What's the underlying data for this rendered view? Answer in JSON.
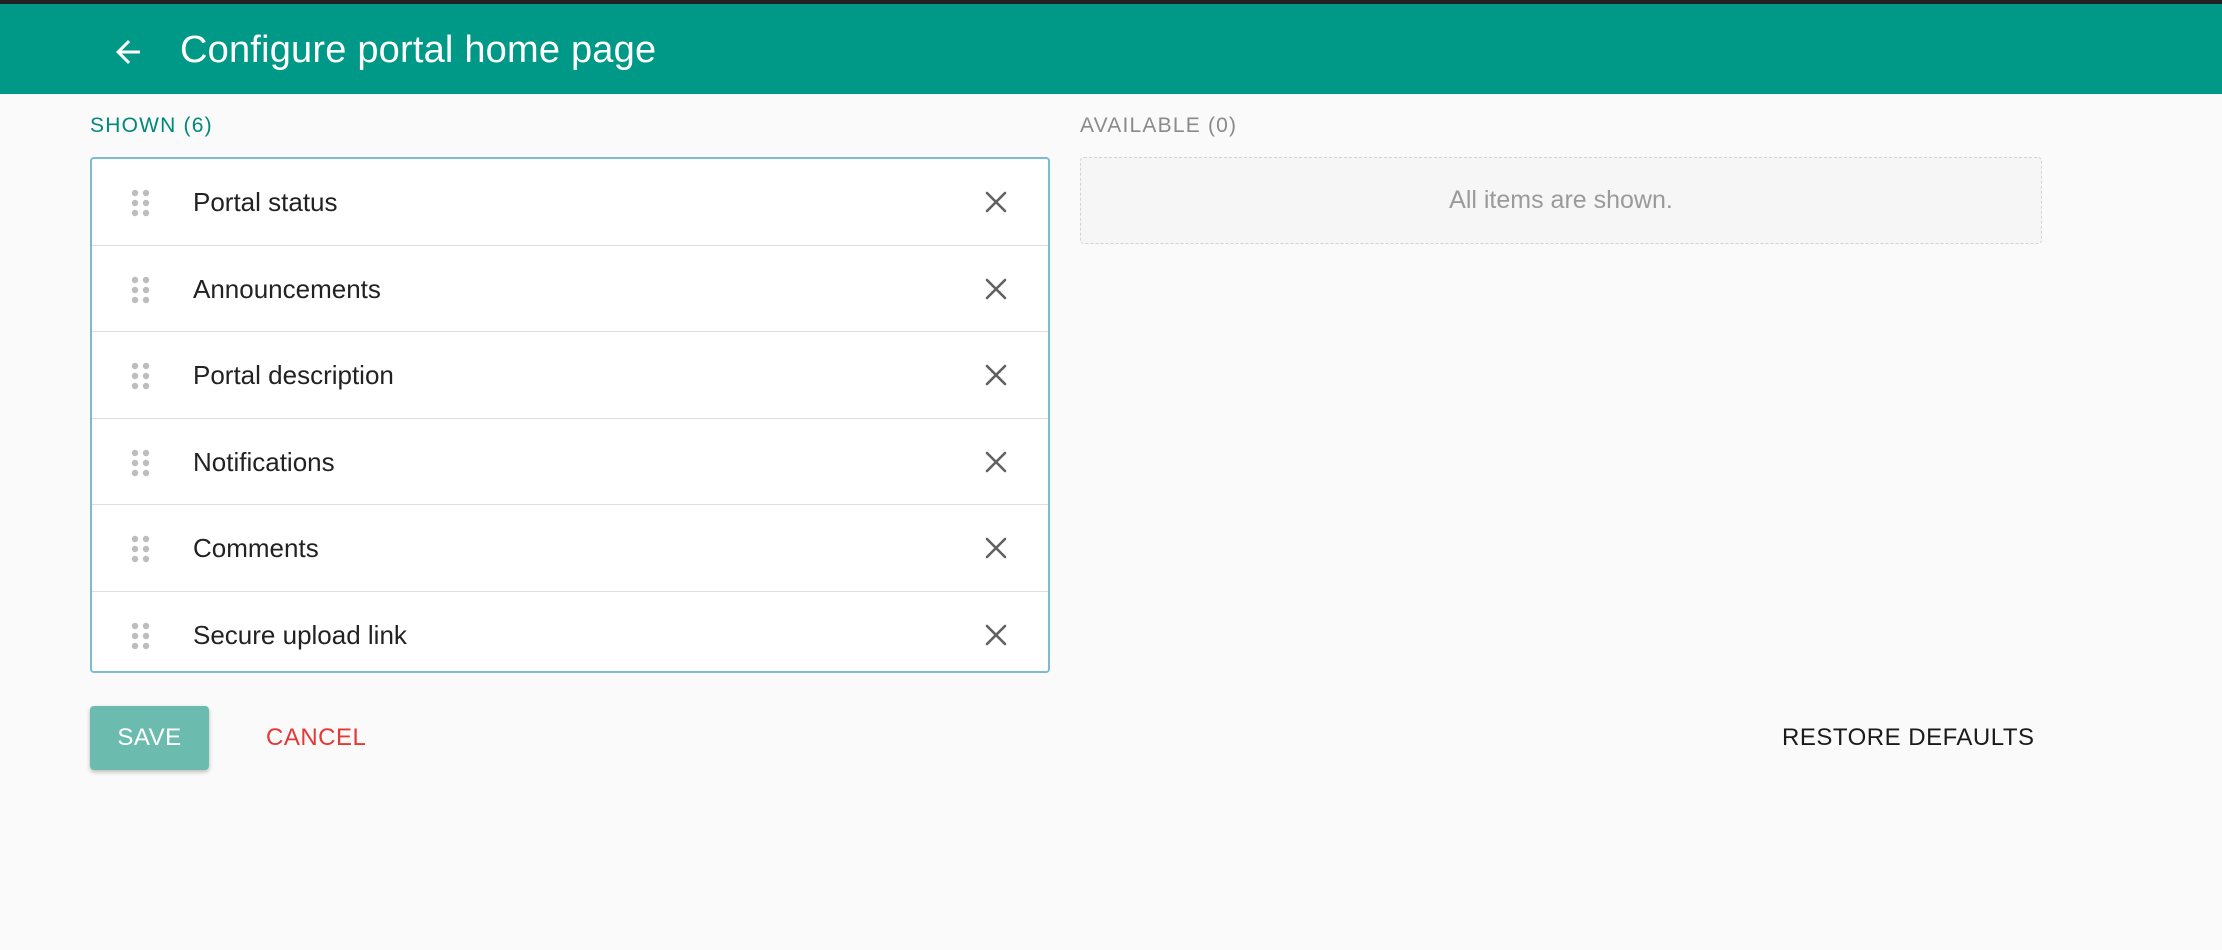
{
  "header": {
    "title": "Configure portal home page",
    "back_icon": "arrow-left-icon",
    "background_color": "#009887"
  },
  "shown": {
    "label": "SHOWN (6)",
    "items": [
      {
        "label": "Portal status"
      },
      {
        "label": "Announcements"
      },
      {
        "label": "Portal description"
      },
      {
        "label": "Notifications"
      },
      {
        "label": "Comments"
      },
      {
        "label": "Secure upload link"
      }
    ],
    "drag_icon": "drag-handle-icon",
    "remove_icon": "close-icon"
  },
  "available": {
    "label": "AVAILABLE (0)",
    "empty_text": "All items are shown."
  },
  "actions": {
    "save_label": "SAVE",
    "cancel_label": "CANCEL",
    "restore_label": "RESTORE DEFAULTS"
  },
  "colors": {
    "accent": "#009887",
    "save_button": "#6bbcae",
    "cancel_text": "#e53935"
  }
}
